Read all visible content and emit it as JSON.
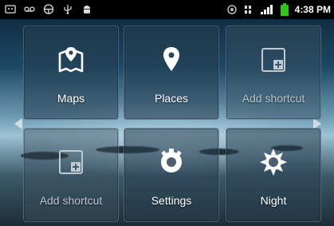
{
  "status_bar": {
    "time": "4:38 PM"
  },
  "shortcuts": [
    {
      "label": "Maps",
      "icon": "maps-icon"
    },
    {
      "label": "Places",
      "icon": "places-pin-icon"
    },
    {
      "label": "Add shortcut",
      "icon": "add-shortcut-icon"
    },
    {
      "label": "Add shortcut",
      "icon": "add-shortcut-icon"
    },
    {
      "label": "Settings",
      "icon": "settings-icon"
    },
    {
      "label": "Night",
      "icon": "night-mode-sun-icon"
    }
  ],
  "colors": {
    "status_bar_bg": "#000000",
    "tile_bg": "#283e50",
    "battery_green": "#35c21f"
  }
}
